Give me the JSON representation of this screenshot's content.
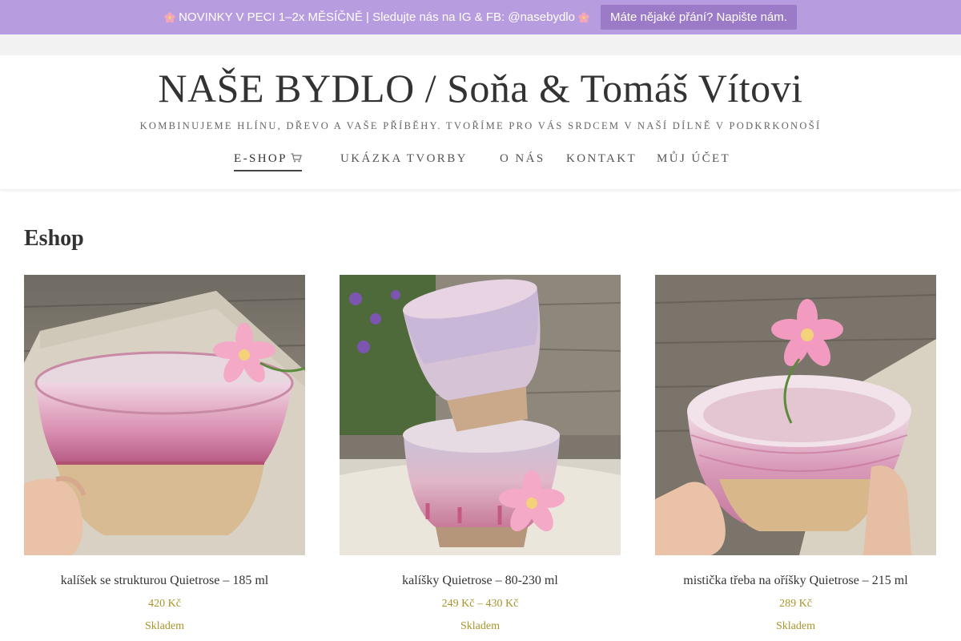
{
  "notice": {
    "text": "NOVINKY V PECI 1–2x MĚSÍČNĚ | Sledujte nás na IG & FB: @nasebydlo",
    "button_label": "Máte nějaké přání? Napište nám."
  },
  "header": {
    "site_title": "NAŠE BYDLO / Soňa & Tomáš Vítovi",
    "tagline": "KOMBINUJEME HLÍNU, DŘEVO A VAŠE PŘÍBĚHY. TVOŘÍME PRO VÁS SRDCEM V NAŠÍ DÍLNĚ V PODKRKONOŠÍ"
  },
  "nav": {
    "items": [
      {
        "label": "E-SHOP",
        "icon": "cart-icon",
        "active": true
      },
      {
        "label": "UKÁZKA TVORBY"
      },
      {
        "label": "O NÁS"
      },
      {
        "label": "KONTAKT"
      },
      {
        "label": "MŮJ ÚČET"
      }
    ]
  },
  "main": {
    "page_title": "Eshop",
    "products": [
      {
        "name": "kalíšek se strukturou Quietrose – 185 ml",
        "price": "420 Kč",
        "stock": "Skladem"
      },
      {
        "name": "kalíšky Quietrose – 80-230 ml",
        "price": "249 Kč – 430 Kč",
        "stock": "Skladem"
      },
      {
        "name": "mistička třeba na oříšky Quietrose – 215 ml",
        "price": "289 Kč",
        "stock": "Skladem"
      }
    ]
  },
  "colors": {
    "notice_bg": "#b79de0",
    "notice_button_bg": "#9b7bc7",
    "price": "#a8942a"
  }
}
